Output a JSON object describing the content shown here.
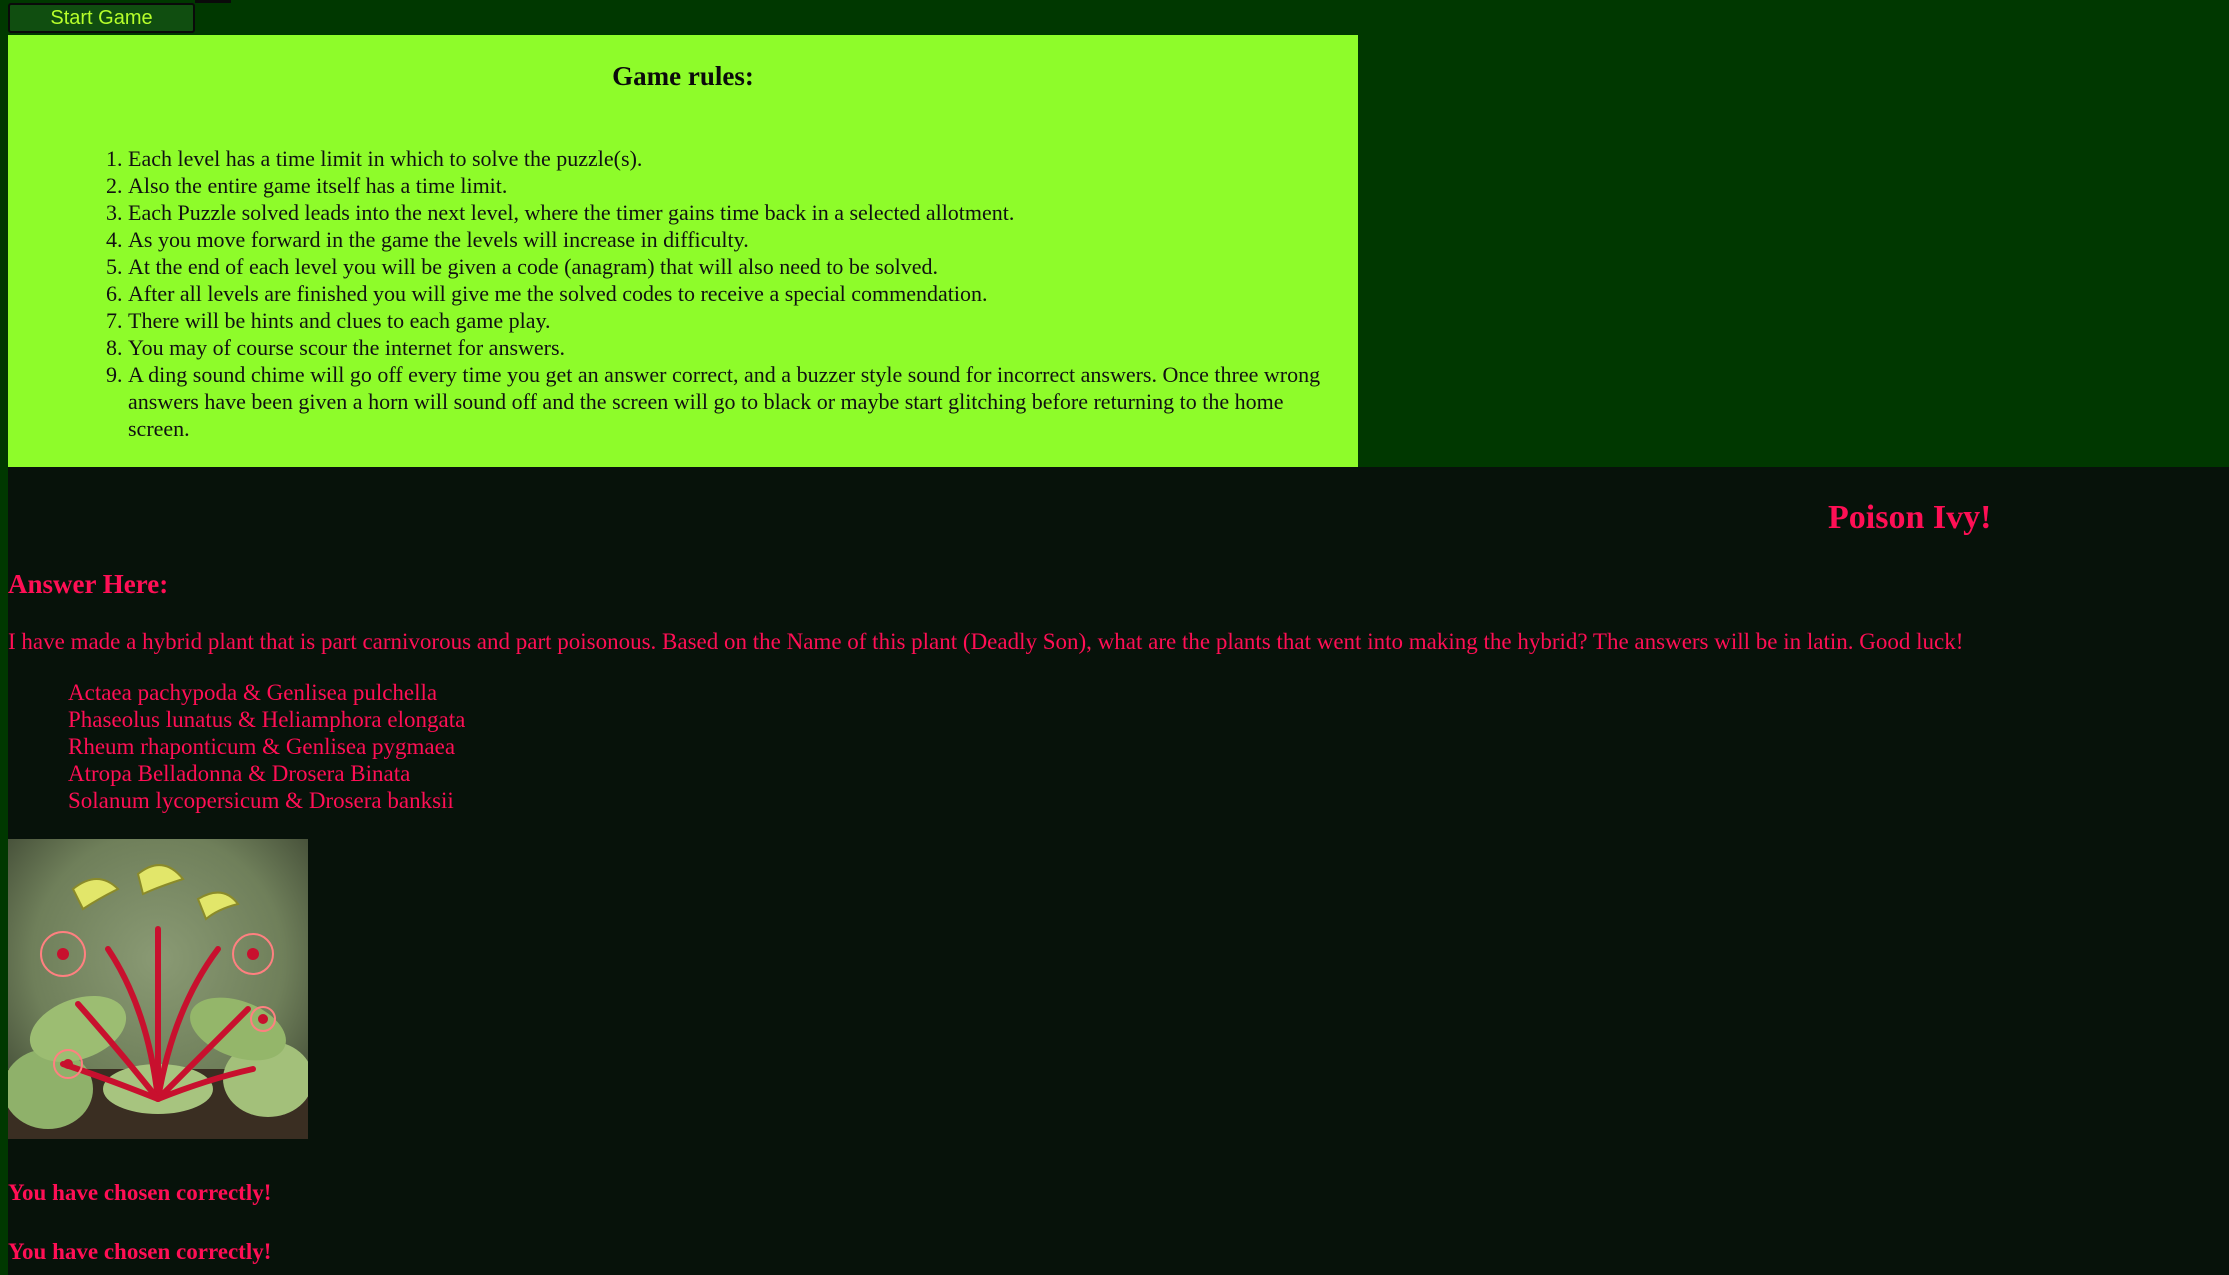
{
  "toolbar": {
    "start_label": "Start Game"
  },
  "rules": {
    "title": "Game rules:",
    "items": [
      "Each level has a time limit in which to solve the puzzle(s).",
      "Also the entire game itself has a time limit.",
      "Each Puzzle solved leads into the next level, where the timer gains time back in a selected allotment.",
      "As you move forward in the game the levels will increase in difficulty.",
      "At the end of each level you will be given a code (anagram) that will also need to be solved.",
      "After all levels are finished you will give me the solved codes to receive a special commendation.",
      "There will be hints and clues to each game play.",
      "You may of course scour the internet for answers.",
      "A ding sound chime will go off every time you get an answer correct, and a buzzer style sound for incorrect answers. Once three wrong answers have been given a horn will sound off and the screen will go to black or maybe start glitching before returning to the home screen."
    ]
  },
  "level": {
    "title": "Poison Ivy!",
    "answer_heading": "Answer Here:",
    "question": "I have made a hybrid plant that is part carnivorous and part poisonous. Based on the Name of this plant (Deadly Son), what are the plants that went into making the hybrid? The answers will be in latin. Good luck!",
    "options": [
      "Actaea pachypoda & Genlisea pulchella",
      "Phaseolus lunatus & Heliamphora elongata",
      "Rheum rhaponticum & Genlisea pygmaea",
      "Atropa Belladonna & Drosera Binata",
      "Solanum lycopersicum & Drosera banksii"
    ],
    "results": [
      "You have chosen correctly!",
      "You have chosen correctly!"
    ]
  },
  "colors": {
    "page_bg": "#003800",
    "rules_bg": "#8efc2a",
    "lower_bg": "#07120a",
    "accent_pink": "#ff0f55",
    "button_text": "#b6ff2b"
  }
}
